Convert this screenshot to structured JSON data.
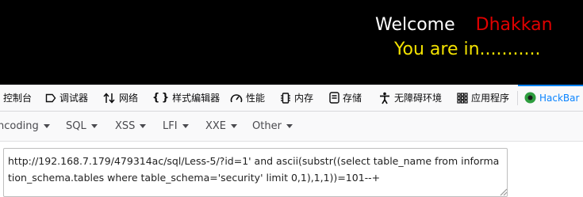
{
  "page": {
    "welcome_text": "Welcome",
    "user_name": "Dhakkan",
    "status_text": "You are in..........."
  },
  "devtools": {
    "tabs": [
      {
        "label": "控制台",
        "icon": "console-icon"
      },
      {
        "label": "调试器",
        "icon": "debugger-icon"
      },
      {
        "label": "网络",
        "icon": "network-arrows-icon"
      },
      {
        "label": "样式编辑器",
        "icon": "braces-icon"
      },
      {
        "label": "性能",
        "icon": "gauge-icon"
      },
      {
        "label": "内存",
        "icon": "memory-chip-icon"
      },
      {
        "label": "存储",
        "icon": "storage-icon"
      },
      {
        "label": "无障碍环境",
        "icon": "accessibility-icon"
      },
      {
        "label": "应用程序",
        "icon": "app-grid-icon"
      },
      {
        "label": "HackBar",
        "icon": "hackbar-logo-icon",
        "active": true
      }
    ]
  },
  "hackbar": {
    "menu": [
      "ncoding",
      "SQL",
      "XSS",
      "LFI",
      "XXE",
      "Other"
    ],
    "url_value": "http://192.168.7.179/479314ac/sql/Less-5/?id=1' and ascii(substr((select table_name from information_schema.tables where table_schema='security' limit 0,1),1,1))=101--+"
  },
  "colors": {
    "stage_bg": "#000000",
    "welcome": "#ffffff",
    "user_name": "#e00000",
    "status": "#f3e200",
    "accent": "#0a84ff",
    "hackbar_logo": "#2e9e3f"
  }
}
